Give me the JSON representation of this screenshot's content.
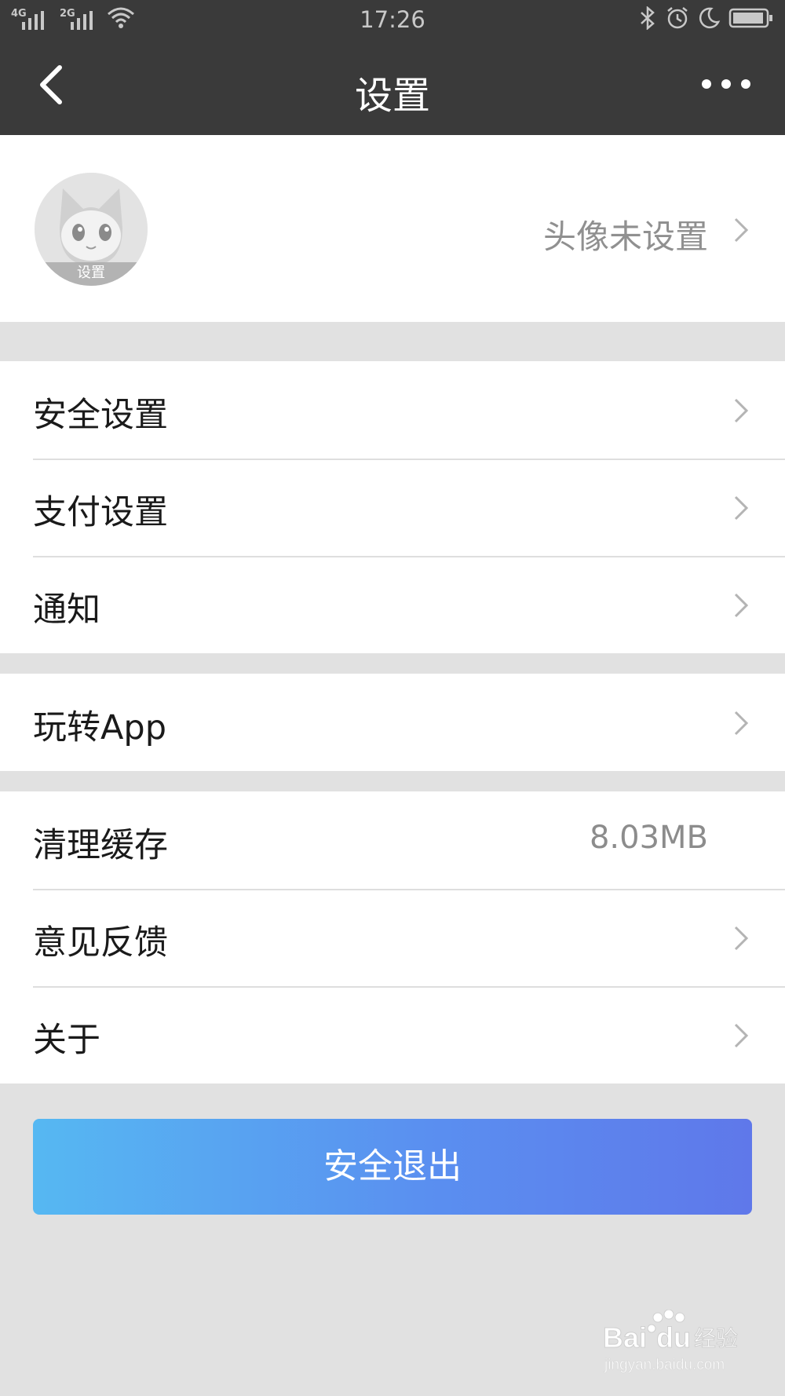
{
  "status_bar": {
    "network_1": "4G",
    "network_2": "2G",
    "time": "17:26"
  },
  "nav": {
    "title": "设置"
  },
  "profile": {
    "avatar_caption": "设置",
    "status": "头像未设置"
  },
  "groups": [
    {
      "items": [
        {
          "label": "安全设置"
        },
        {
          "label": "支付设置"
        },
        {
          "label": "通知"
        }
      ]
    },
    {
      "items": [
        {
          "label": "玩转App"
        }
      ]
    },
    {
      "items": [
        {
          "label": "清理缓存",
          "value": "8.03MB"
        },
        {
          "label": "意见反馈"
        },
        {
          "label": "关于"
        }
      ]
    }
  ],
  "logout_label": "安全退出",
  "watermark": {
    "brand": "Baidu经验",
    "url": "jingyan.baidu.com"
  },
  "colors": {
    "nav_background": "#3a3a3a",
    "page_background": "#e1e1e1",
    "button_gradient_start": "#56b8f2",
    "button_gradient_end": "#5f78ea"
  },
  "icons": [
    "signal-icon",
    "wifi-icon",
    "bluetooth-icon",
    "alarm-icon",
    "moon-icon",
    "battery-icon",
    "back-arrow-icon",
    "more-dots-icon",
    "chevron-right-icon"
  ]
}
